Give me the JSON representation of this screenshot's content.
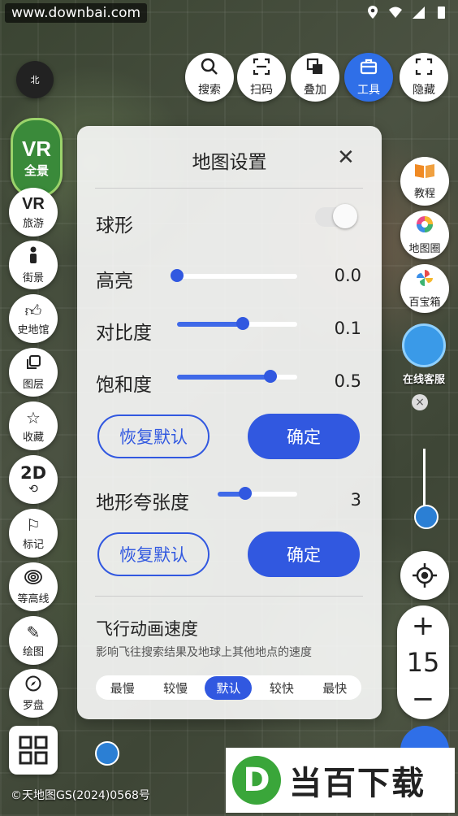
{
  "status_bar": {
    "watermark": "www.downbai.com"
  },
  "toolbar": {
    "search": "搜索",
    "scan": "扫码",
    "overlay": "叠加",
    "tools": "工具",
    "hide": "隐藏"
  },
  "left": {
    "compass_label": "北",
    "vr_big": "VR",
    "vr_small": "全景",
    "travel": "旅游",
    "street": "街景",
    "history": "史地馆",
    "layers": "图层",
    "favorites": "收藏",
    "mode": "2D",
    "mark": "标记",
    "contour": "等高线",
    "draw": "绘图",
    "compass": "罗盘"
  },
  "right": {
    "tutorial": "教程",
    "map_circle": "地图圈",
    "toolbox": "百宝箱",
    "service": "在线客服",
    "zoom_level": "15",
    "zoom_in": "+",
    "zoom_out": "−"
  },
  "dialog": {
    "title": "地图设置",
    "sphere_label": "球形",
    "brightness_label": "高亮",
    "brightness_value": "0.0",
    "contrast_label": "对比度",
    "contrast_value": "0.1",
    "saturation_label": "饱和度",
    "saturation_value": "0.5",
    "reset_label": "恢复默认",
    "confirm_label": "确定",
    "terrain_label": "地形夸张度",
    "terrain_value": "3",
    "reset2_label": "恢复默认",
    "confirm2_label": "确定",
    "fly_title": "飞行动画速度",
    "fly_desc": "影响飞往搜索结果及地球上其他地点的速度",
    "speeds": [
      "最慢",
      "较慢",
      "默认",
      "较快",
      "最快"
    ],
    "speed_selected": "默认",
    "sliders": {
      "brightness": 0.0,
      "contrast": 0.55,
      "saturation": 0.78,
      "terrain": 0.35
    },
    "sphere_on": false
  },
  "footer": {
    "copyright": "©天地图GS(2024)0568号",
    "brand": "当百下载"
  },
  "colors": {
    "accent": "#3158e0"
  }
}
